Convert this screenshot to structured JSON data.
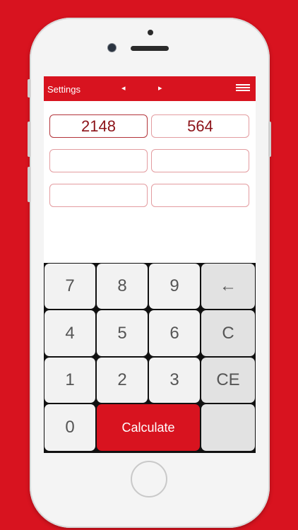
{
  "toolbar": {
    "settings_label": "Settings",
    "prev_arrow": "◂",
    "next_arrow": "▸",
    "menu_icon": "hamburger-menu-icon"
  },
  "fields": {
    "row1": [
      "2148",
      "564"
    ],
    "row2": [
      "",
      ""
    ],
    "row3": [
      "",
      ""
    ]
  },
  "keypad": {
    "k7": "7",
    "k8": "8",
    "k9": "9",
    "backspace": "←",
    "k4": "4",
    "k5": "5",
    "k6": "6",
    "clear": "C",
    "k1": "1",
    "k2": "2",
    "k3": "3",
    "clear_entry": "CE",
    "k0": "0",
    "calculate": "Calculate"
  },
  "colors": {
    "accent": "#d8131f",
    "field_text": "#8c1218",
    "key_bg": "#f2f2f2"
  }
}
